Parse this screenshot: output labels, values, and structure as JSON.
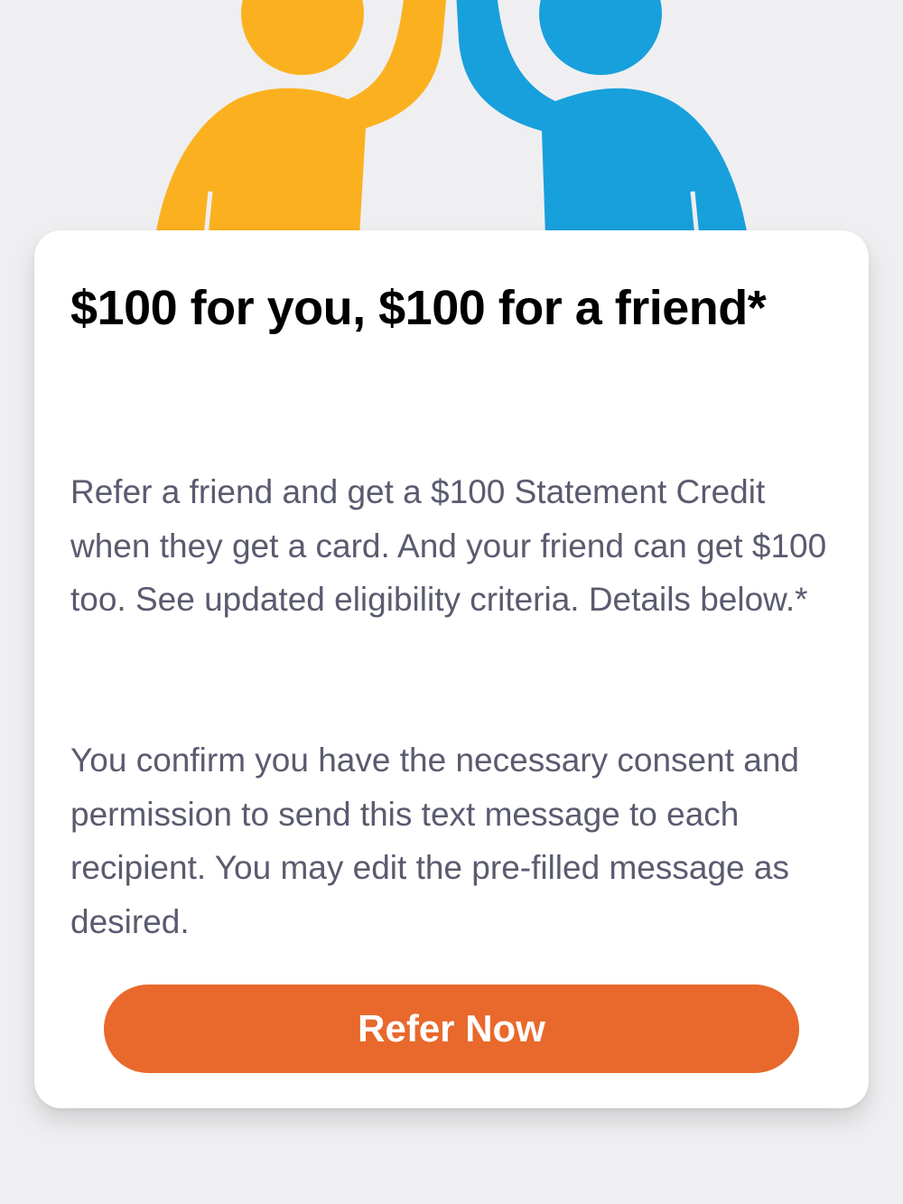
{
  "hero": {
    "illustration": "high-five-illustration",
    "colors": {
      "left_person": "#fbb11f",
      "right_person": "#18a0dc"
    }
  },
  "card": {
    "title": "$100 for you, $100 for a friend*",
    "description": "Refer a friend and get a $100 Statement Credit when they get a card. And your friend can get $100 too. See updated eligibility criteria. Details below.*",
    "consent": "You confirm you have the necessary consent and permission to send this text message to each recipient. You may edit the pre-filled message as desired.",
    "refer_button_label": "Refer Now",
    "accent_color": "#e8692b"
  }
}
